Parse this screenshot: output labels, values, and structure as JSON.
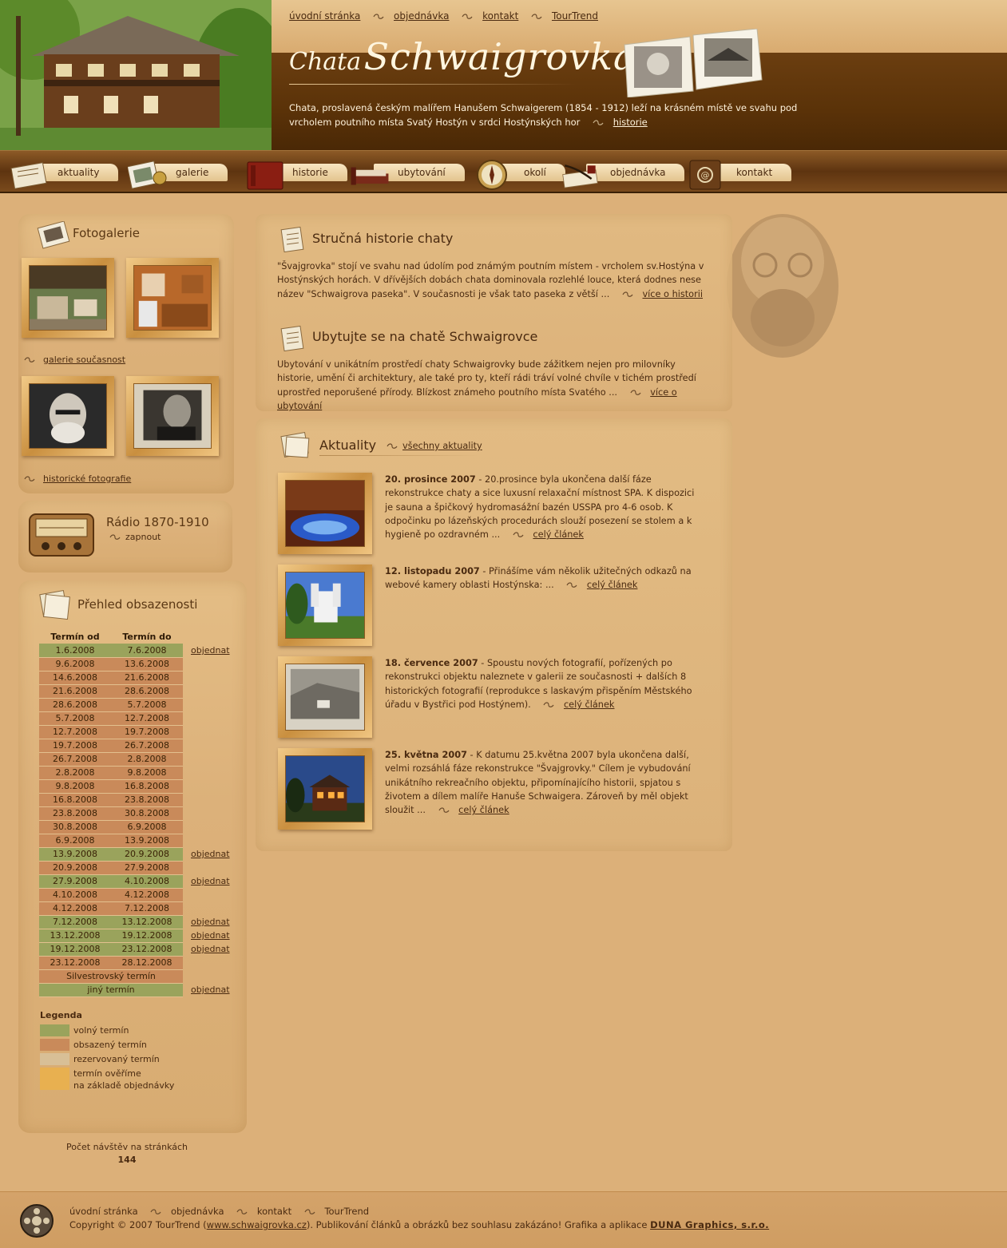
{
  "header": {
    "top_nav": [
      "úvodní stránka",
      "objednávka",
      "kontakt",
      "TourTrend"
    ],
    "logo_small": "Chata",
    "logo_big": "Schwaigrovka",
    "intro_text": "Chata, proslavená českým malířem Hanušem Schwaigerem (1854 - 1912) leží na krásném místě ve svahu pod vrcholem poutního místa Svatý Hostýn v srdci Hostýnských hor",
    "intro_link": "historie"
  },
  "main_nav": [
    {
      "label": "aktuality",
      "icon": "newspaper-icon"
    },
    {
      "label": "galerie",
      "icon": "photos-icon"
    },
    {
      "label": "historie",
      "icon": "book-icon"
    },
    {
      "label": "ubytování",
      "icon": "bed-icon"
    },
    {
      "label": "okolí",
      "icon": "compass-icon"
    },
    {
      "label": "objednávka",
      "icon": "quill-icon"
    },
    {
      "label": "kontakt",
      "icon": "address-book-icon"
    }
  ],
  "sidebar": {
    "gallery_title": "Fotogalerie",
    "gallery_link_1": "galerie současnost",
    "gallery_link_2": "historické fotografie",
    "radio_title": "Rádio 1870-1910",
    "radio_link": "zapnout",
    "occupancy_title": "Přehled obsazenosti",
    "occupancy_headers": [
      "Termín od",
      "Termín do"
    ],
    "occupancy_rows": [
      {
        "from": "1.6.2008",
        "to": "7.6.2008",
        "status": "free",
        "action": "objednat"
      },
      {
        "from": "9.6.2008",
        "to": "13.6.2008",
        "status": "busy",
        "action": ""
      },
      {
        "from": "14.6.2008",
        "to": "21.6.2008",
        "status": "busy",
        "action": ""
      },
      {
        "from": "21.6.2008",
        "to": "28.6.2008",
        "status": "busy",
        "action": ""
      },
      {
        "from": "28.6.2008",
        "to": "5.7.2008",
        "status": "busy",
        "action": ""
      },
      {
        "from": "5.7.2008",
        "to": "12.7.2008",
        "status": "busy",
        "action": ""
      },
      {
        "from": "12.7.2008",
        "to": "19.7.2008",
        "status": "busy",
        "action": ""
      },
      {
        "from": "19.7.2008",
        "to": "26.7.2008",
        "status": "busy",
        "action": ""
      },
      {
        "from": "26.7.2008",
        "to": "2.8.2008",
        "status": "busy",
        "action": ""
      },
      {
        "from": "2.8.2008",
        "to": "9.8.2008",
        "status": "busy",
        "action": ""
      },
      {
        "from": "9.8.2008",
        "to": "16.8.2008",
        "status": "busy",
        "action": ""
      },
      {
        "from": "16.8.2008",
        "to": "23.8.2008",
        "status": "busy",
        "action": ""
      },
      {
        "from": "23.8.2008",
        "to": "30.8.2008",
        "status": "busy",
        "action": ""
      },
      {
        "from": "30.8.2008",
        "to": "6.9.2008",
        "status": "busy",
        "action": ""
      },
      {
        "from": "6.9.2008",
        "to": "13.9.2008",
        "status": "busy",
        "action": ""
      },
      {
        "from": "13.9.2008",
        "to": "20.9.2008",
        "status": "free",
        "action": "objednat"
      },
      {
        "from": "20.9.2008",
        "to": "27.9.2008",
        "status": "busy",
        "action": ""
      },
      {
        "from": "27.9.2008",
        "to": "4.10.2008",
        "status": "free",
        "action": "objednat"
      },
      {
        "from": "4.10.2008",
        "to": "4.12.2008",
        "status": "busy",
        "action": ""
      },
      {
        "from": "4.12.2008",
        "to": "7.12.2008",
        "status": "busy",
        "action": ""
      },
      {
        "from": "7.12.2008",
        "to": "13.12.2008",
        "status": "free",
        "action": "objednat"
      },
      {
        "from": "13.12.2008",
        "to": "19.12.2008",
        "status": "free",
        "action": "objednat"
      },
      {
        "from": "19.12.2008",
        "to": "23.12.2008",
        "status": "free",
        "action": "objednat"
      },
      {
        "from": "23.12.2008",
        "to": "28.12.2008",
        "status": "busy",
        "action": ""
      }
    ],
    "special_rows": [
      {
        "label": "Silvestrovský termín",
        "status": "busy",
        "action": ""
      },
      {
        "label": "jiný termín",
        "status": "free",
        "action": "objednat"
      }
    ],
    "legend_title": "Legenda",
    "legend": [
      {
        "label": "volný termín",
        "color": "#9aa35c"
      },
      {
        "label": "obsazený termín",
        "color": "#c98a5a"
      },
      {
        "label": "rezervovaný termín",
        "color": "#d8bf96"
      },
      {
        "label": "termín ověříme",
        "label2": "na základě objednávky",
        "color": "#e8b050"
      }
    ],
    "visits_label": "Počet návštěv na stránkách",
    "visits_count": "144"
  },
  "content": {
    "history_title": "Stručná historie chaty",
    "history_text": "\"Švajgrovka\" stojí ve svahu nad údolím pod známým poutním místem - vrcholem sv.Hostýna v Hostýnských horách. V dřívějších dobách chata dominovala rozlehlé louce, která dodnes nese název \"Schwaigrova paseka\". V současnosti je však tato paseka z větší ...",
    "history_link": "více o historii",
    "stay_title": "Ubytujte se na chatě Schwaigrovce",
    "stay_text": "Ubytování v unikátním prostředí chaty Schwaigrovky bude zážitkem nejen pro milovníky historie, umění či architektury, ale také pro ty, kteří rádi tráví volné chvíle v tichém prostředí uprostřed neporušené přírody. Blízkost známeho poutního místa Svatého ...",
    "stay_link": "více o ubytování",
    "news_title": "Aktuality",
    "news_all_link": "všechny aktuality",
    "news": [
      {
        "date": "20. prosince 2007",
        "text": " - 20.prosince byla ukončena další fáze rekonstrukce chaty a sice luxusní relaxační místnost SPA. K dispozici je sauna a špičkový hydromasážní bazén USSPA pro 4-6 osob. K odpočinku po lázeňských procedurách slouží posezení se stolem a k hygieně po ozdravném ...",
        "link": "celý článek"
      },
      {
        "date": "12. listopadu 2007",
        "text": " - Přinášíme vám několik užitečných odkazů na webové kamery oblasti Hostýnska: ...",
        "link": "celý článek"
      },
      {
        "date": "18. července 2007",
        "text": " - Spoustu nových fotografií, pořízených po rekonstrukci objektu naleznete v galerii ze současnosti + dalších 8 historických fotografií (reprodukce s laskavým přispěním Městského úřadu v Bystřici pod Hostýnem).",
        "link": "celý článek"
      },
      {
        "date": "25. května 2007",
        "text": " - K datumu 25.května 2007 byla ukončena další, velmi rozsáhlá fáze rekonstrukce \"Švajgrovky.\" Cílem je vybudování unikátního rekreačního objektu, připomínajícího historii, spjatou s životem a dílem malíře Hanuše Schwaigera. Zároveň by měl objekt sloužit ...",
        "link": "celý článek"
      }
    ]
  },
  "footer": {
    "nav": [
      "úvodní stránka",
      "objednávka",
      "kontakt",
      "TourTrend"
    ],
    "copy_prefix": "Copyright © 2007 TourTrend (",
    "copy_url": "www.schwaigrovka.cz",
    "copy_mid": "). Publikování článků a obrázků bez souhlasu zakázáno! Grafika a aplikace ",
    "copy_author": "DUNA Graphics, s.r.o."
  },
  "colors": {
    "background": "#dcb079",
    "header_band": "#5a3208",
    "free": "#9aa35c",
    "busy": "#c98a5a",
    "text": "#4a2a10"
  }
}
